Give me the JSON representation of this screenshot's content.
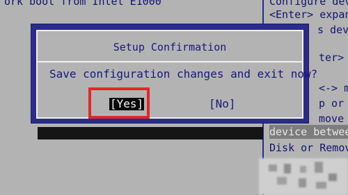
{
  "background": {
    "top_left_text": "ork boot from Intel E1000",
    "right_panel": {
      "line1": "Configure dev",
      "line2": "<Enter> expan",
      "line3": "s dev",
      "line4": "ter>",
      "line5": "<-> m",
      "line6": "p or",
      "line7": "move",
      "highlighted_line": "device betwee",
      "line9": "Disk or Remov"
    }
  },
  "dialog": {
    "title": "Setup Confirmation",
    "message": "Save configuration changes and exit now?",
    "yes_label": "[Yes]",
    "no_label": "[No]"
  },
  "colors": {
    "background": "#b3b3b3",
    "dialog_frame": "#2b2b88",
    "text": "#18187a",
    "highlight": "#7d7d7d",
    "focus_box": "#e32629"
  }
}
